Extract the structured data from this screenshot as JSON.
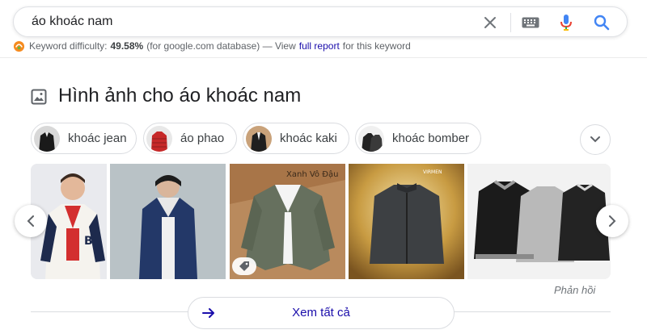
{
  "search": {
    "query": "áo khoác nam",
    "clear_icon": "close-icon",
    "keyboard_icon": "keyboard-icon",
    "mic_icon": "microphone-icon",
    "search_icon": "search-icon"
  },
  "keyword": {
    "label": "Keyword difficulty:",
    "value": "49.58%",
    "db_note": "(for google.com database) — View",
    "link": "full report",
    "suffix": "for this keyword"
  },
  "images_section": {
    "heading": "Hình ảnh cho áo khoác nam",
    "chips": [
      {
        "label": "khoác jean"
      },
      {
        "label": "áo phao"
      },
      {
        "label": "khoác kaki"
      },
      {
        "label": "khoác bomber"
      }
    ],
    "tile3_caption": "Xanh Vô Đậu",
    "tile4_caption": "VIRMEN",
    "feedback": "Phản hồi",
    "see_all": "Xem tất cả"
  },
  "colors": {
    "link": "#1a0dab",
    "text": "#202124",
    "muted": "#5f6368",
    "border": "#dadce0",
    "mic_red": "#ea4335",
    "mic_blue": "#4285f4"
  }
}
